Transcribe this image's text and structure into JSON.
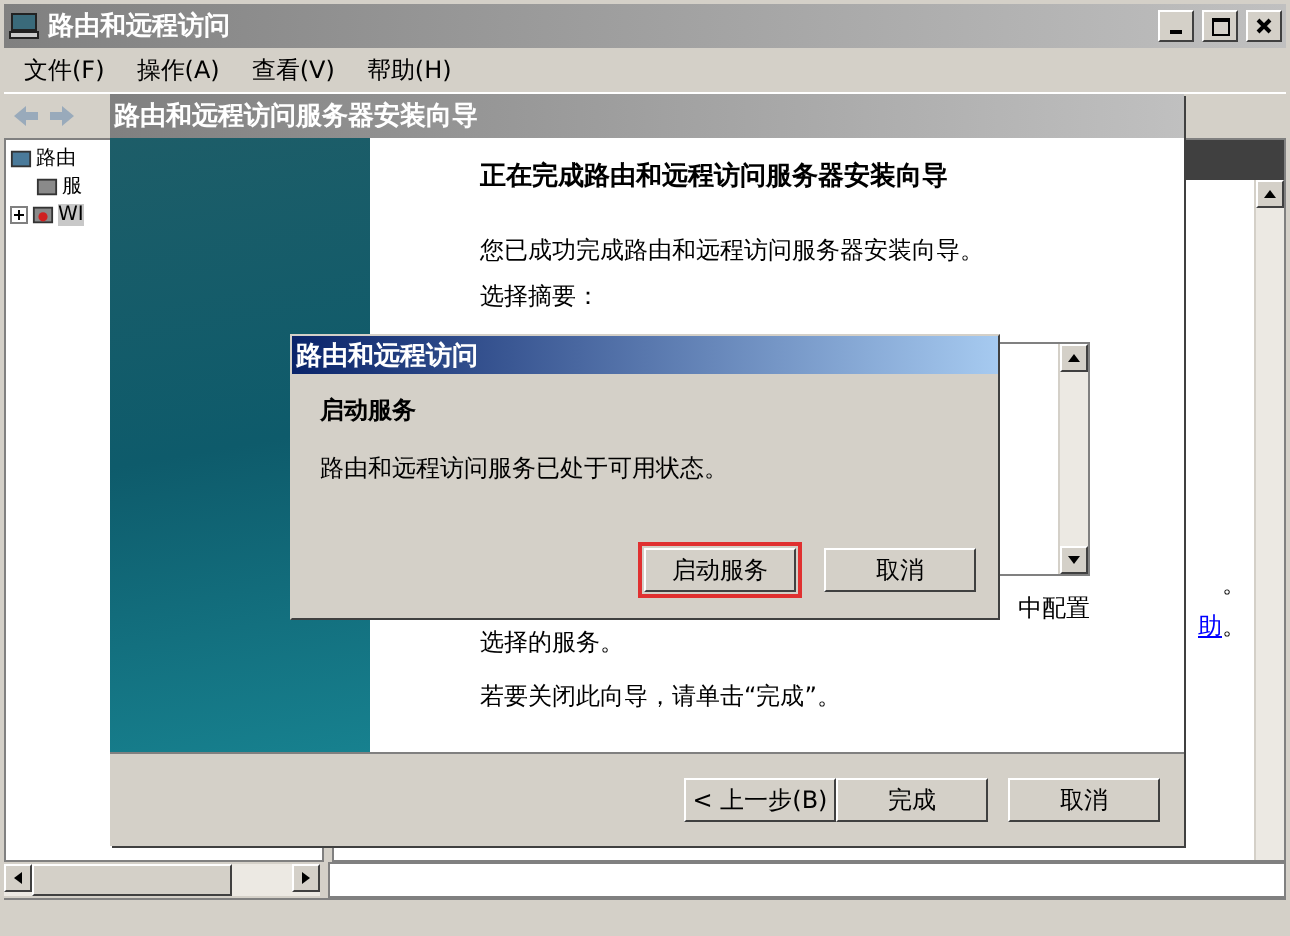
{
  "main_window": {
    "title": "路由和远程访问",
    "menu": [
      "文件(F)",
      "操作(A)",
      "查看(V)",
      "帮助(H)"
    ],
    "tree": [
      {
        "label": "路由",
        "selected": false,
        "children": [
          {
            "label": "服",
            "selected": false
          },
          {
            "label": "WI",
            "expanded": false,
            "selected": true
          }
        ]
      }
    ],
    "right_pane": {
      "text": "。",
      "link": "助",
      "link_suffix": "。"
    }
  },
  "wizard": {
    "title": "路由和远程访问服务器安装向导",
    "heading": "正在完成路由和远程访问服务器安装向导",
    "intro": "您已成功完成路由和远程访问服务器安装向导。",
    "summary_label": "选择摘要：",
    "note_fragment": "中配置",
    "note_line": "选择的服务。",
    "closing": "若要关闭此向导，请单击“完成”。",
    "buttons": [
      "< 上一步(B)",
      "完成",
      "取消"
    ]
  },
  "dialog": {
    "title": "路由和远程访问",
    "heading": "启动服务",
    "message": "路由和远程访问服务已处于可用状态。",
    "buttons": [
      {
        "label": "启动服务",
        "highlighted": true
      },
      {
        "label": "取消",
        "highlighted": false
      }
    ]
  }
}
